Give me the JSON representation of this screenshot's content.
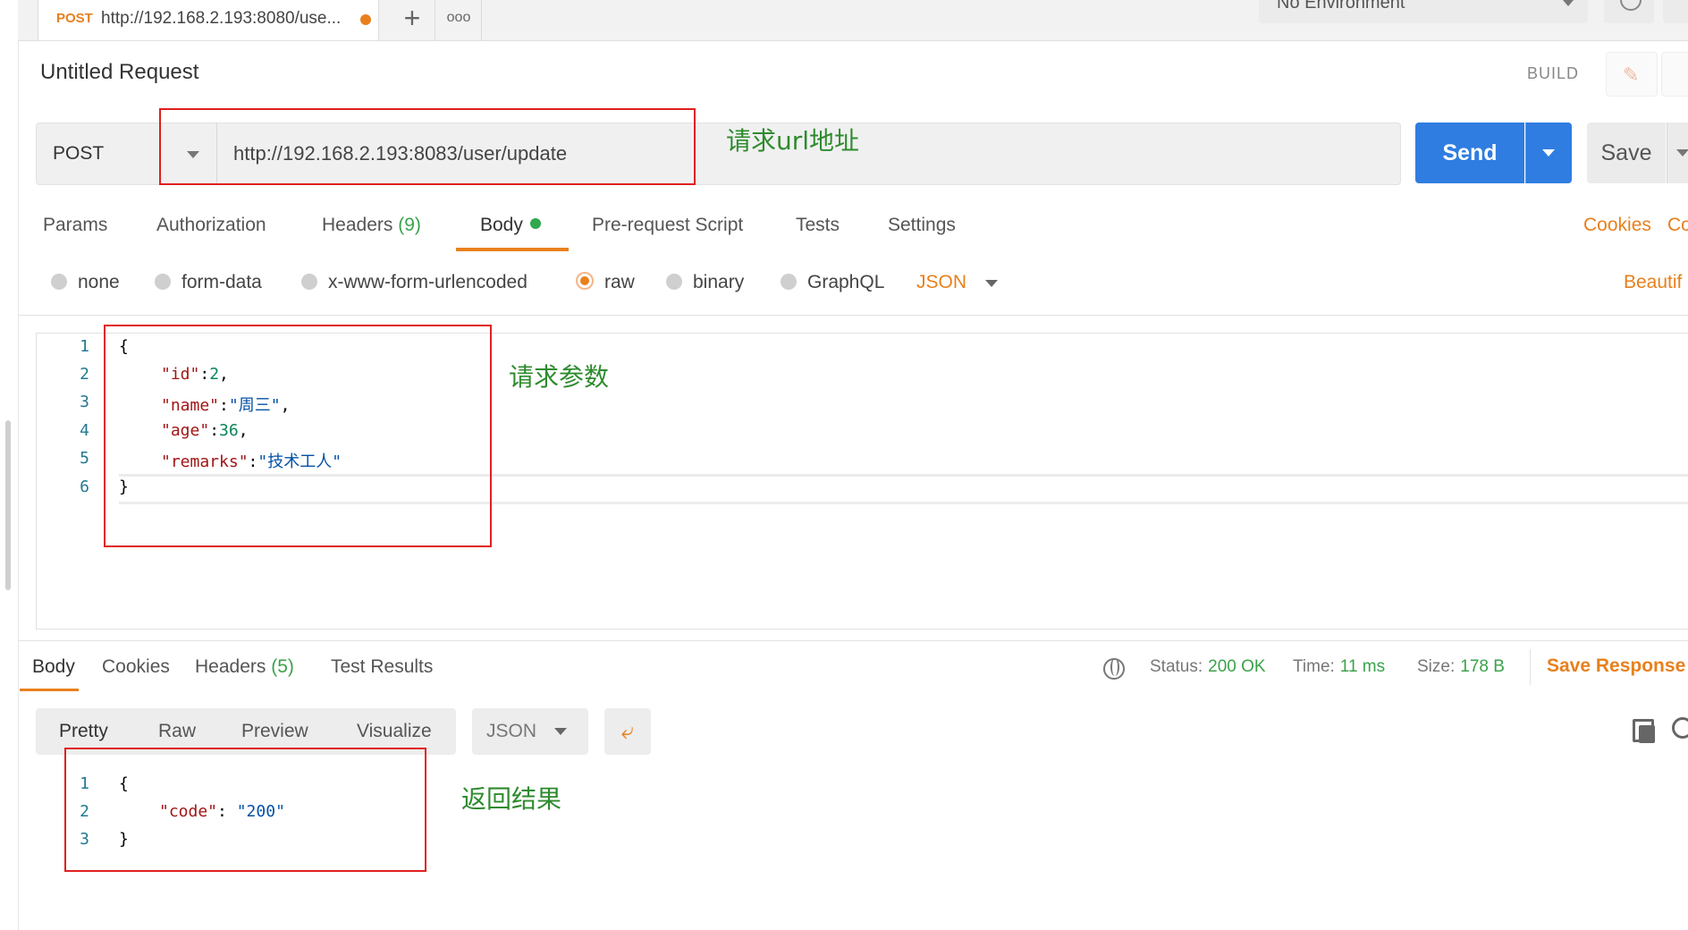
{
  "tab": {
    "method": "POST",
    "url": "http://192.168.2.193:8080/use...",
    "plus": "+",
    "more": "ooo"
  },
  "environment": {
    "label": "No Environment"
  },
  "request": {
    "title": "Untitled Request",
    "build_label": "BUILD",
    "method": "POST",
    "url": "http://192.168.2.193:8083/user/update",
    "send_label": "Send",
    "save_label": "Save"
  },
  "request_tabs": {
    "params": "Params",
    "authorization": "Authorization",
    "headers": "Headers",
    "headers_count": "(9)",
    "body": "Body",
    "pre_request": "Pre-request Script",
    "tests": "Tests",
    "settings": "Settings",
    "cookies": "Cookies",
    "code": "Co"
  },
  "body_types": {
    "none": "none",
    "form_data": "form-data",
    "urlencoded": "x-www-form-urlencoded",
    "raw": "raw",
    "binary": "binary",
    "graphql": "GraphQL",
    "format": "JSON",
    "beautify": "Beautif"
  },
  "request_body": {
    "line_numbers": [
      "1",
      "2",
      "3",
      "4",
      "5",
      "6"
    ],
    "l1": "{",
    "l2_key": "\"id\"",
    "l2_colon": ":",
    "l2_val": "2",
    "l2_end": ",",
    "l3_key": "\"name\"",
    "l3_colon": ":",
    "l3_val": "\"周三\"",
    "l3_end": ",",
    "l4_key": "\"age\"",
    "l4_colon": ":",
    "l4_val": "36",
    "l4_end": ",",
    "l5_key": "\"remarks\"",
    "l5_colon": ":",
    "l5_val": "\"技术工人\"",
    "l6": "}"
  },
  "response": {
    "tabs": {
      "body": "Body",
      "cookies": "Cookies",
      "headers": "Headers",
      "headers_count": "(5)",
      "test_results": "Test Results"
    },
    "status_label": "Status:",
    "status_value": "200 OK",
    "time_label": "Time:",
    "time_value": "11 ms",
    "size_label": "Size:",
    "size_value": "178 B",
    "save_response": "Save Response",
    "views": {
      "pretty": "Pretty",
      "raw": "Raw",
      "preview": "Preview",
      "visualize": "Visualize"
    },
    "format": "JSON",
    "line_numbers": [
      "1",
      "2",
      "3"
    ],
    "l1": "{",
    "l2_key": "\"code\"",
    "l2_colon": ": ",
    "l2_val": "\"200\"",
    "l3": "}"
  },
  "annotations": {
    "url_note": "请求url地址",
    "params_note": "请求参数",
    "result_note": "返回结果",
    "box_color": "#e02020",
    "text_color": "#2e8b2e"
  },
  "colors": {
    "accent": "#e8801d",
    "send_blue": "#2f7de1",
    "success_green": "#3aa24b"
  }
}
